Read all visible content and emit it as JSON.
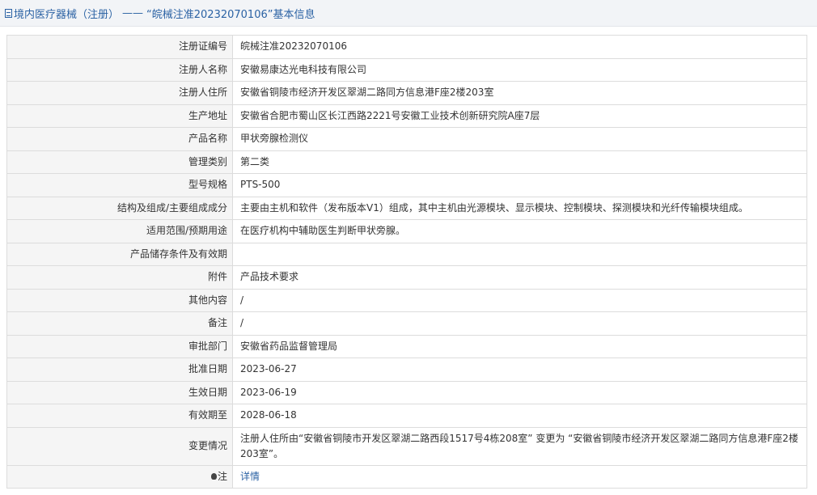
{
  "header": {
    "category": "境内医疗器械（注册）",
    "separator": "——",
    "title": "“皖械注准20232070106”基本信息"
  },
  "rows": [
    {
      "label": "注册证编号",
      "value": "皖械注准20232070106"
    },
    {
      "label": "注册人名称",
      "value": "安徽易康达光电科技有限公司"
    },
    {
      "label": "注册人住所",
      "value": "安徽省铜陵市经济开发区翠湖二路同方信息港F座2楼203室"
    },
    {
      "label": "生产地址",
      "value": "安徽省合肥市蜀山区长江西路2221号安徽工业技术创新研究院A座7层"
    },
    {
      "label": "产品名称",
      "value": "甲状旁腺检测仪"
    },
    {
      "label": "管理类别",
      "value": "第二类"
    },
    {
      "label": "型号规格",
      "value": "PTS-500"
    },
    {
      "label": "结构及组成/主要组成成分",
      "value": "主要由主机和软件（发布版本V1）组成，其中主机由光源模块、显示模块、控制模块、探测模块和光纤传输模块组成。"
    },
    {
      "label": "适用范围/预期用途",
      "value": "在医疗机构中辅助医生判断甲状旁腺。"
    },
    {
      "label": "产品储存条件及有效期",
      "value": ""
    },
    {
      "label": "附件",
      "value": "产品技术要求"
    },
    {
      "label": "其他内容",
      "value": "/"
    },
    {
      "label": "备注",
      "value": "/"
    },
    {
      "label": "审批部门",
      "value": "安徽省药品监督管理局"
    },
    {
      "label": "批准日期",
      "value": "2023-06-27"
    },
    {
      "label": "生效日期",
      "value": "2023-06-19"
    },
    {
      "label": "有效期至",
      "value": "2028-06-18"
    },
    {
      "label": "变更情况",
      "value": "注册人住所由“安徽省铜陵市开发区翠湖二路西段1517号4栋208室” 变更为 “安徽省铜陵市经济开发区翠湖二路同方信息港F座2楼203室”。"
    }
  ],
  "note_row": {
    "label": "注",
    "icon": "lightbulb-icon",
    "link_text": "详情"
  },
  "colors": {
    "title_text": "#2b62a4",
    "label_bg": "#f5f5f5",
    "border": "#dcdcdc",
    "link": "#2b62a4"
  }
}
